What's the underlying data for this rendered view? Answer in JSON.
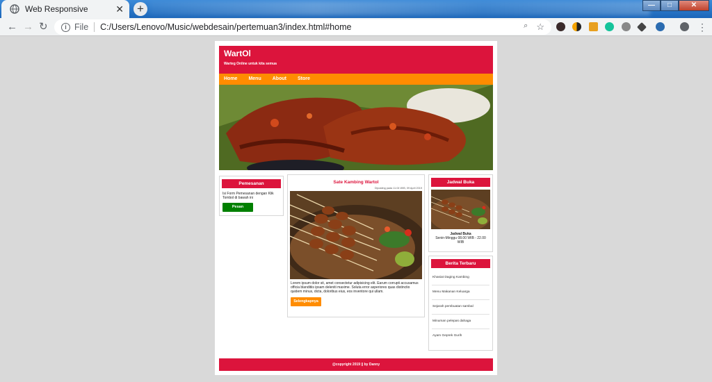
{
  "browser": {
    "tab_title": "Web Responsive",
    "tab_close": "✕",
    "new_tab": "+",
    "scheme_label": "File",
    "url": "C:/Users/Lenovo/Music/webdesain/pertemuan3/index.html#home",
    "back_icon": "←",
    "forward_icon": "→",
    "reload_icon": "↻",
    "zoom_icon": "🔍",
    "star_icon": "☆",
    "menu_icon": "⋮",
    "window_minimize": "—",
    "window_maximize": "□",
    "window_close": "✕"
  },
  "site": {
    "logo": "WartOl",
    "tagline": "Warteg Online untuk kita semua",
    "menu": [
      "Home",
      "Menu",
      "About",
      "Store"
    ]
  },
  "order": {
    "title": "Pemesanan",
    "text": "Isi Form Pemesanan dengan Klik Tombol di bawah ini",
    "button": "Pesan"
  },
  "article": {
    "title": "Sate Kambing Wartol",
    "meta": "Diposting pada 11.04 WIB, 09 April 2019",
    "body": "Lorem ipsum dolor sit, amet consectetur adipisicing elit. Earum corrupti accusamus officia blanditiis ipsam deleniti maxime. Soluta error asperiores quas distinctio quidem minus, dicta, doloribus eius, eos inventore qui ullam.",
    "button": "Selengkapnya"
  },
  "hours": {
    "title": "Jadwal Buka",
    "label": "Jadwal Buka",
    "value": "Senin-Minggu 08.00 WIB - 22.00 WIB"
  },
  "news": {
    "title": "Berita Terbaru",
    "items": [
      "Khasiat Daging Kambing",
      "Menu Makanan Keluarga",
      "Sejarah pembuatan sambal",
      "Minuman pelepas dahaga",
      "Ayam Geprek Gurih"
    ]
  },
  "footer": {
    "text": "@copyright 2019 || by Danny"
  },
  "colors": {
    "primary": "#dc143c",
    "accent": "#ff8c00",
    "green": "#008000"
  }
}
